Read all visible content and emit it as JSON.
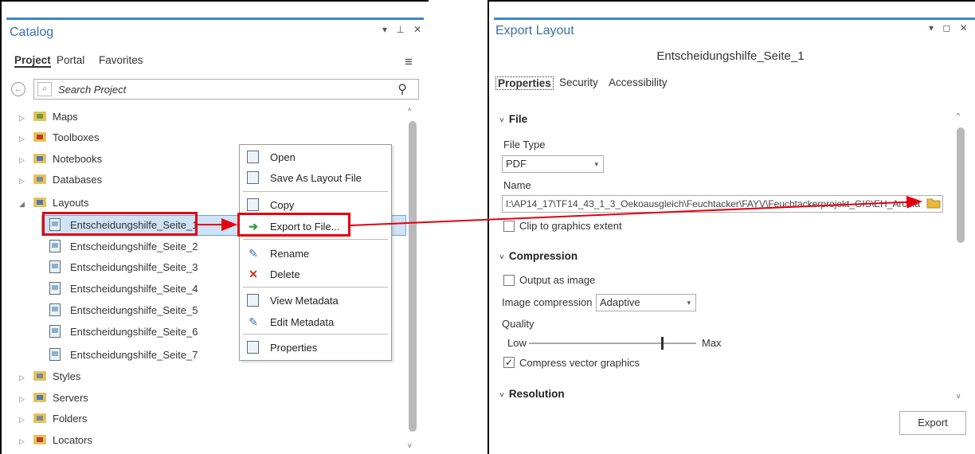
{
  "catalog": {
    "title": "Catalog",
    "window_controls": "▾ ⊥ ✕",
    "tabs": [
      "Project",
      "Portal",
      "Favorites"
    ],
    "menu_icon": "hamburger-icon",
    "search_placeholder": "Search Project",
    "tree": [
      {
        "label": "Maps",
        "icon": "folder-icon"
      },
      {
        "label": "Toolboxes",
        "icon": "folder-icon"
      },
      {
        "label": "Notebooks",
        "icon": "folder-icon"
      },
      {
        "label": "Databases",
        "icon": "folder-icon"
      },
      {
        "label": "Layouts",
        "icon": "folder-icon"
      },
      {
        "label": "Entscheidungshilfe_Seite_1",
        "icon": "layout-icon"
      },
      {
        "label": "Entscheidungshilfe_Seite_2",
        "icon": "layout-icon"
      },
      {
        "label": "Entscheidungshilfe_Seite_3",
        "icon": "layout-icon"
      },
      {
        "label": "Entscheidungshilfe_Seite_4",
        "icon": "layout-icon"
      },
      {
        "label": "Entscheidungshilfe_Seite_5",
        "icon": "layout-icon"
      },
      {
        "label": "Entscheidungshilfe_Seite_6",
        "icon": "layout-icon"
      },
      {
        "label": "Entscheidungshilfe_Seite_7",
        "icon": "layout-icon"
      },
      {
        "label": "Styles",
        "icon": "folder-icon"
      },
      {
        "label": "Servers",
        "icon": "folder-icon"
      },
      {
        "label": "Folders",
        "icon": "folder-icon"
      },
      {
        "label": "Locators",
        "icon": "folder-icon"
      }
    ]
  },
  "context_menu": {
    "items": [
      "Open",
      "Save As Layout File",
      "Copy",
      "Export to File...",
      "Rename",
      "Delete",
      "View Metadata",
      "Edit Metadata",
      "Properties"
    ]
  },
  "export": {
    "title": "Export Layout",
    "window_controls": "▾ ◻ ✕",
    "layout_name": "Entscheidungshilfe_Seite_1",
    "tabs": [
      "Properties",
      "Security",
      "Accessibility"
    ],
    "file_section": "File",
    "file_type_label": "File Type",
    "file_type_value": "PDF",
    "name_label": "Name",
    "name_value": "I:\\AP14_17\\TF14_43_1_3_Oekoausgleich\\Feuchtacker\\FAYV\\Feuchtackerprojekt_GIS\\EH_ArcMa",
    "clip_label": "Clip to graphics extent",
    "clip_checked": false,
    "compression_section": "Compression",
    "output_image_label": "Output as image",
    "output_image_checked": false,
    "image_compression_label": "Image compression",
    "image_compression_value": "Adaptive",
    "quality_label": "Quality",
    "quality_low": "Low",
    "quality_max": "Max",
    "quality_level": 0.8,
    "compress_vector_label": "Compress vector graphics",
    "compress_vector_checked": true,
    "resolution_section": "Resolution",
    "export_button": "Export"
  },
  "colors": {
    "highlight": "#e4000f",
    "accent": "#3a86c8",
    "selection": "#cfe3f5"
  }
}
